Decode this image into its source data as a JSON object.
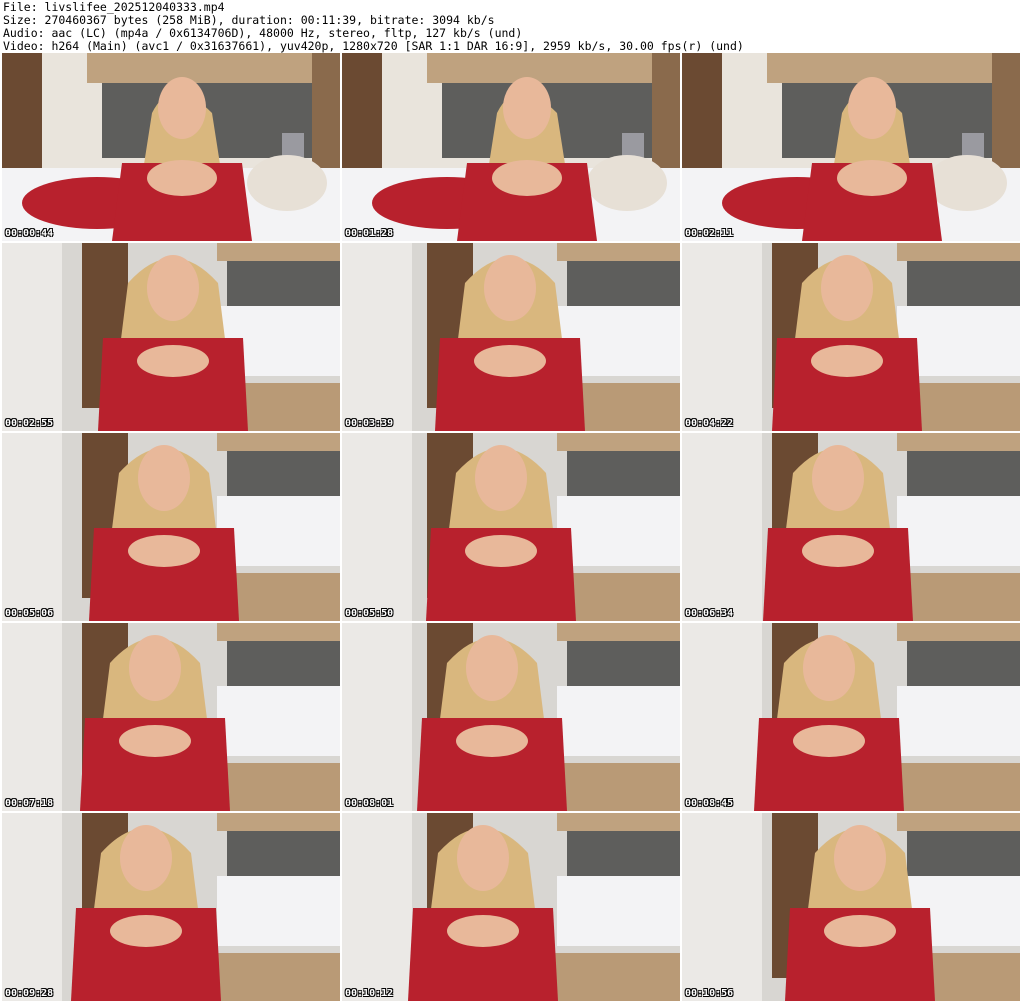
{
  "header": {
    "file_line": "File: livslifee_202512040333.mp4",
    "size_line": "Size: 270460367 bytes (258 MiB), duration: 00:11:39, bitrate: 3094 kb/s",
    "audio_line": "Audio: aac (LC) (mp4a / 0x6134706D), 48000 Hz, stereo, fltp, 127 kb/s (und)",
    "video_line": "Video: h264 (Main) (avc1 / 0x31637661), yuv420p, 1280x720 [SAR 1:1 DAR 16:9], 2959 kb/s, 30.00 fps(r) (und)"
  },
  "thumbnails": [
    {
      "timestamp": "00:00:44",
      "scene": "bed"
    },
    {
      "timestamp": "00:01:28",
      "scene": "bed"
    },
    {
      "timestamp": "00:02:11",
      "scene": "bed"
    },
    {
      "timestamp": "00:02:55",
      "scene": "room"
    },
    {
      "timestamp": "00:03:39",
      "scene": "room"
    },
    {
      "timestamp": "00:04:22",
      "scene": "room"
    },
    {
      "timestamp": "00:05:06",
      "scene": "room"
    },
    {
      "timestamp": "00:05:50",
      "scene": "room"
    },
    {
      "timestamp": "00:06:34",
      "scene": "room"
    },
    {
      "timestamp": "00:07:18",
      "scene": "room"
    },
    {
      "timestamp": "00:08:01",
      "scene": "room"
    },
    {
      "timestamp": "00:08:45",
      "scene": "room"
    },
    {
      "timestamp": "00:09:28",
      "scene": "room"
    },
    {
      "timestamp": "00:10:12",
      "scene": "room"
    },
    {
      "timestamp": "00:10:56",
      "scene": "room"
    }
  ],
  "colors": {
    "outfit": "#b8212d",
    "hair": "#d9b77e",
    "skin": "#e8b89a",
    "wall": "#d8d6d2",
    "door": "#6b4a32",
    "floor": "#b99a76",
    "bed": "#f3f3f5",
    "headboard": "#5e5e5c"
  }
}
